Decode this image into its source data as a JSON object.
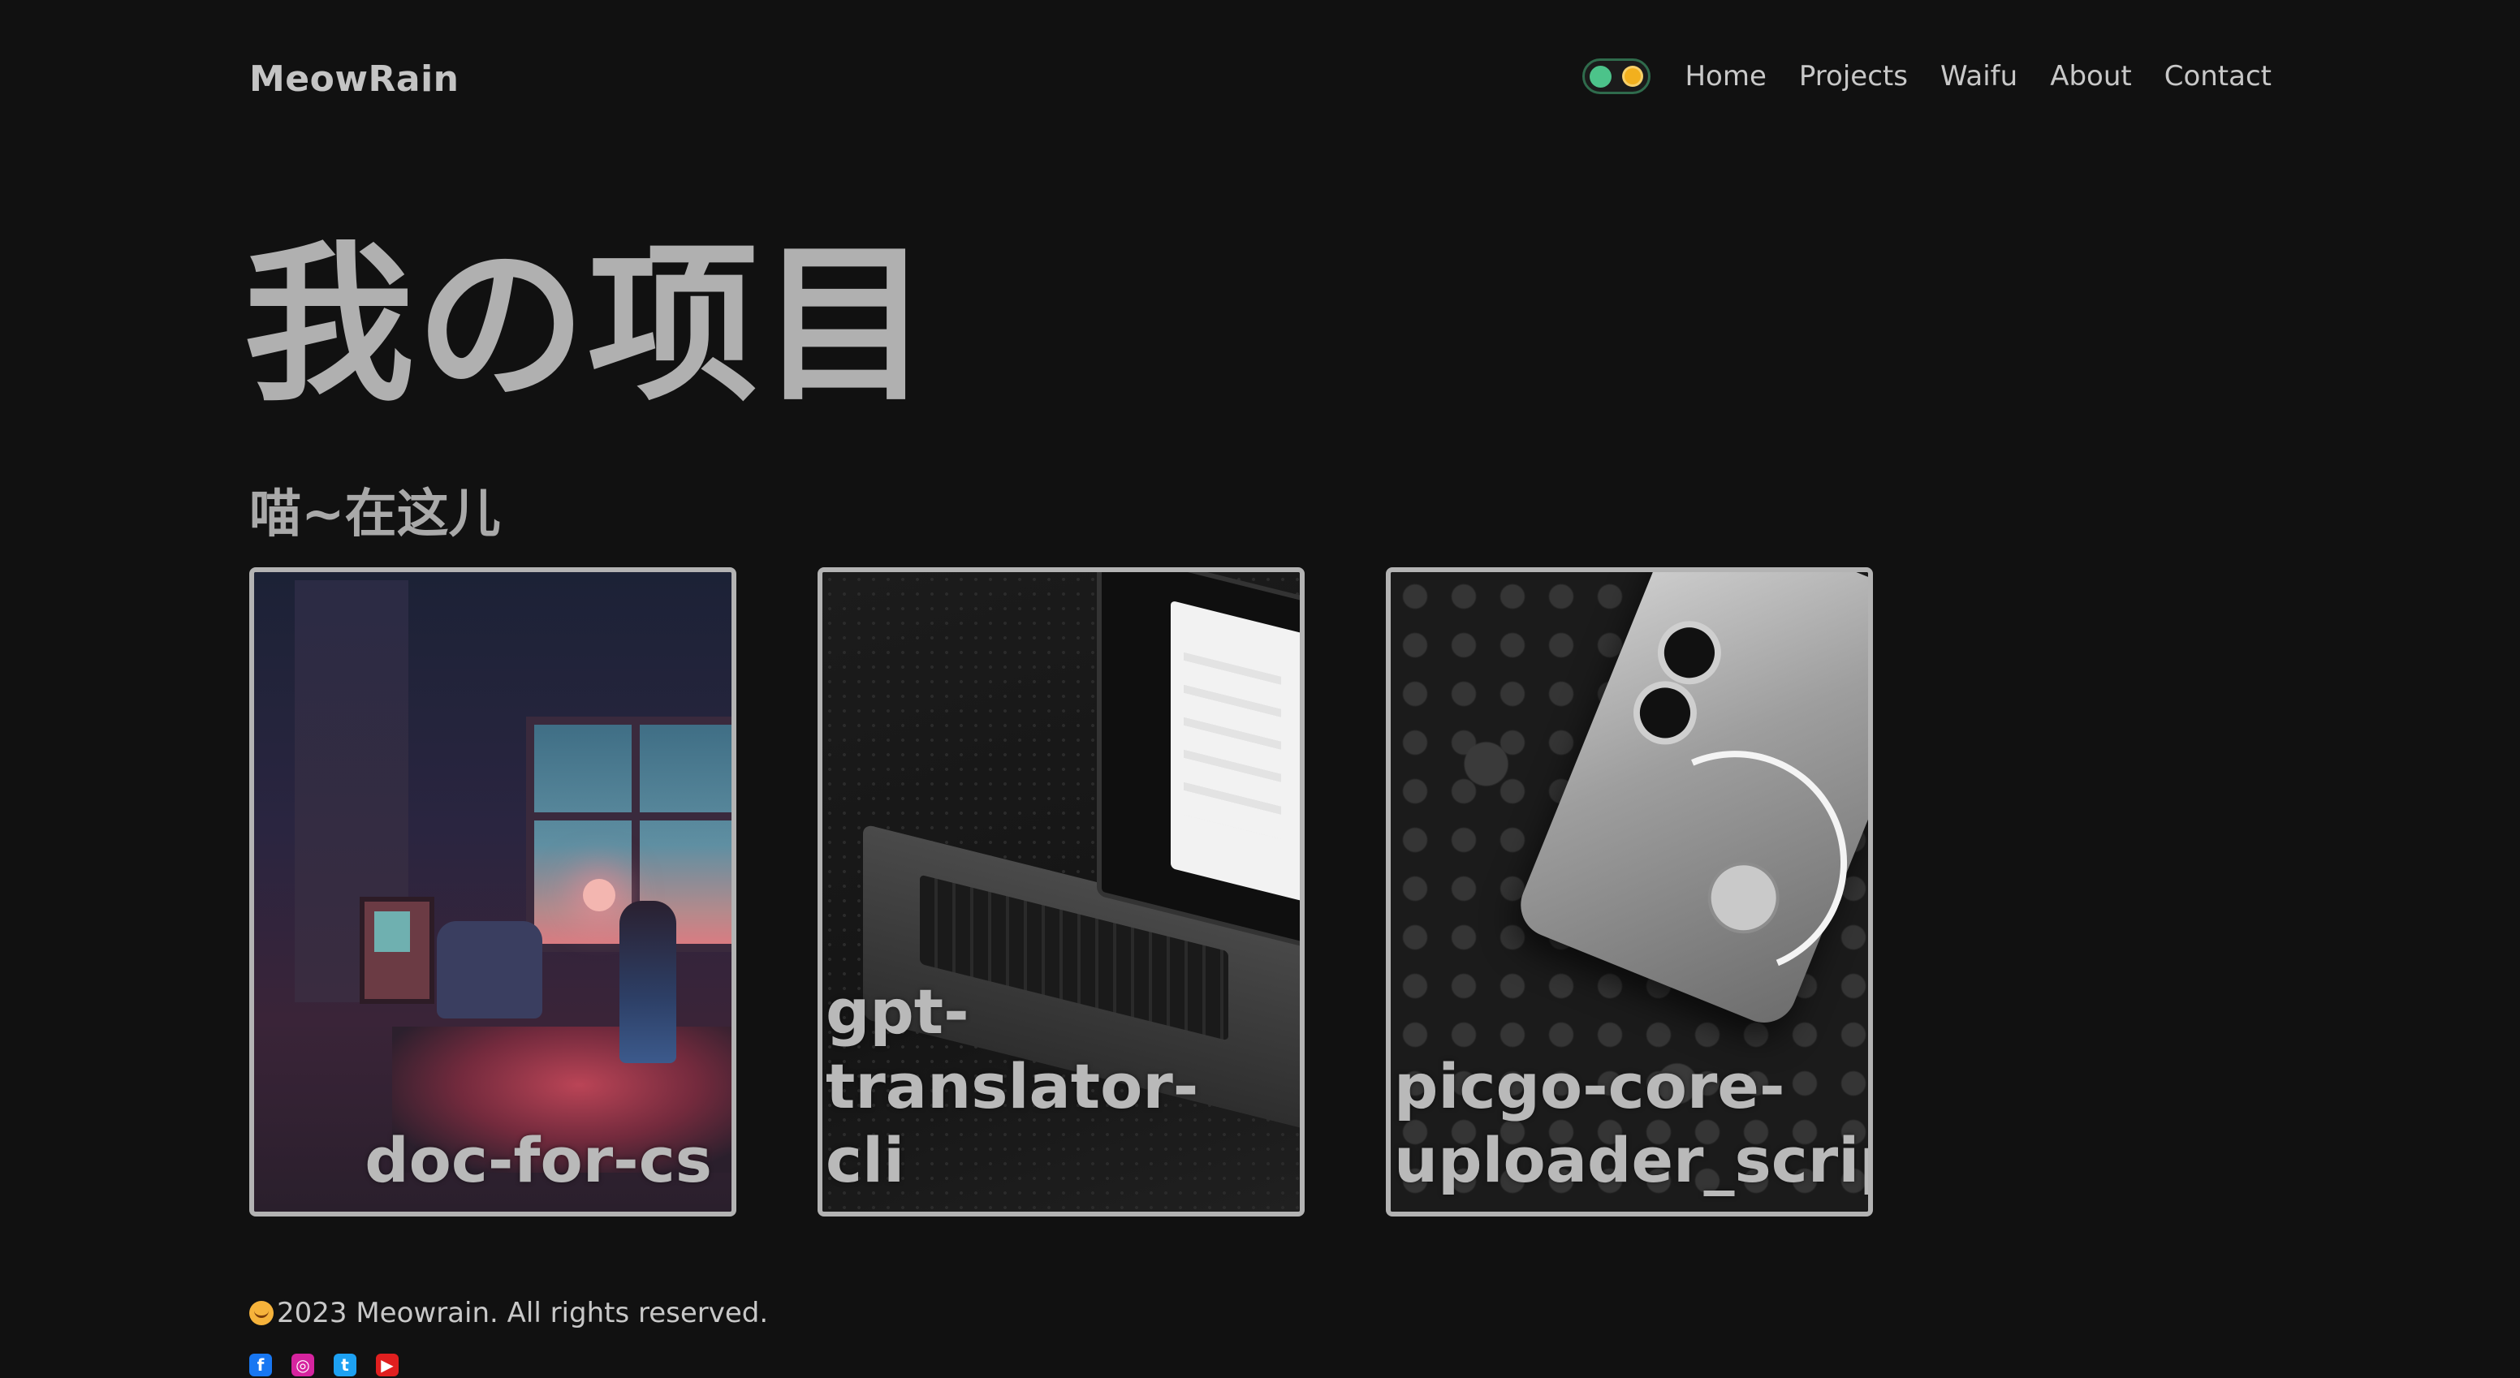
{
  "header": {
    "brand": "MeowRain",
    "nav": [
      {
        "label": "Home"
      },
      {
        "label": "Projects"
      },
      {
        "label": "Waifu"
      },
      {
        "label": "About"
      },
      {
        "label": "Contact"
      }
    ],
    "theme_toggle": {
      "knob_color": "#4cc38a",
      "sun_color": "#f2b01e",
      "state": "dark"
    }
  },
  "hero": {
    "title": "我の项目",
    "subtitle": "喵~在这儿"
  },
  "projects": [
    {
      "title": "doc-for-cs",
      "art": "pixel-room-illustration",
      "label_align": "right"
    },
    {
      "title": "gpt-translator-\ncli",
      "art": "laptop-photo",
      "label_align": "left"
    },
    {
      "title": "picgo-core-\nuploader_script",
      "art": "phone-photo",
      "label_align": "left"
    }
  ],
  "footer": {
    "copyright": "2023 Meowrain. All rights reserved.",
    "social_icons": [
      "facebook-icon",
      "instagram-icon",
      "twitter-icon",
      "youtube-icon"
    ],
    "icon_glyphs": {
      "facebook": "f",
      "instagram": "◎",
      "twitter": "t",
      "youtube": "▶"
    }
  },
  "colors": {
    "background": "#111111",
    "text": "#c8c8c8",
    "card_border": "#b3b3b3"
  }
}
